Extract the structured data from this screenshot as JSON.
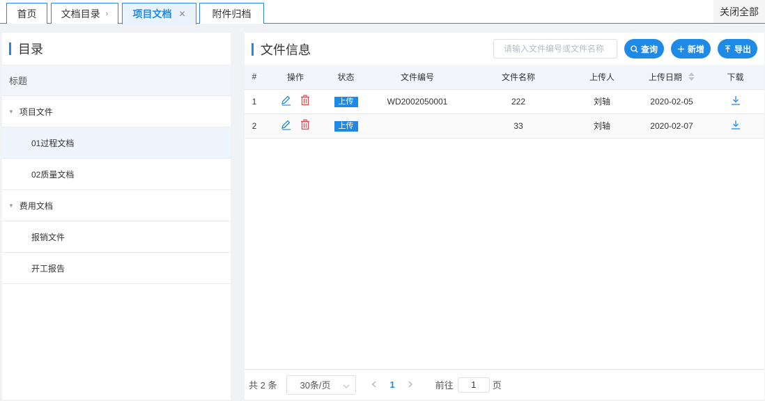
{
  "tabs": [
    {
      "label": "首页"
    },
    {
      "label": "文档目录"
    },
    {
      "label": "项目文档",
      "active": true
    },
    {
      "label": "附件归档"
    }
  ],
  "close_all_label": "关闭全部",
  "left": {
    "title": "目录",
    "column_header": "标题",
    "tree": [
      {
        "label": "项目文件",
        "level": 1,
        "expanded": true
      },
      {
        "label": "01过程文档",
        "level": 2,
        "selected": true
      },
      {
        "label": "02质量文档",
        "level": 2
      },
      {
        "label": "费用文档",
        "level": 1,
        "expanded": true
      },
      {
        "label": "报销文件",
        "level": 2
      },
      {
        "label": "开工报告",
        "level": 2
      }
    ]
  },
  "right": {
    "title": "文件信息",
    "search_placeholder": "请输入文件编号或文件名称",
    "buttons": {
      "query": "查询",
      "add": "新增",
      "export": "导出"
    },
    "table": {
      "columns": [
        "#",
        "操作",
        "状态",
        "文件编号",
        "文件名称",
        "上传人",
        "上传日期",
        "下载"
      ],
      "rows": [
        {
          "index": "1",
          "status": "上传",
          "file_no": "WD2002050001",
          "file_name": "222",
          "uploader": "刘轴",
          "date": "2020-02-05"
        },
        {
          "index": "2",
          "status": "上传",
          "file_no": "",
          "file_name": "33",
          "uploader": "刘轴",
          "date": "2020-02-07"
        }
      ]
    },
    "pagination": {
      "total": "共 2 条",
      "page_size": "30条/页",
      "current_page": "1",
      "goto_label": "前往",
      "goto_value": "1",
      "page_unit": "页"
    }
  },
  "colors": {
    "accent": "#1f8ae5",
    "delete": "#e5484d",
    "header_bg": "#f2f6fa"
  },
  "icons": {
    "edit": "edit-icon",
    "delete": "trash-icon",
    "download": "download-icon",
    "search": "search-icon",
    "add": "plus-icon",
    "export": "upload-icon",
    "sort": "sort-icon",
    "close": "close-icon"
  }
}
